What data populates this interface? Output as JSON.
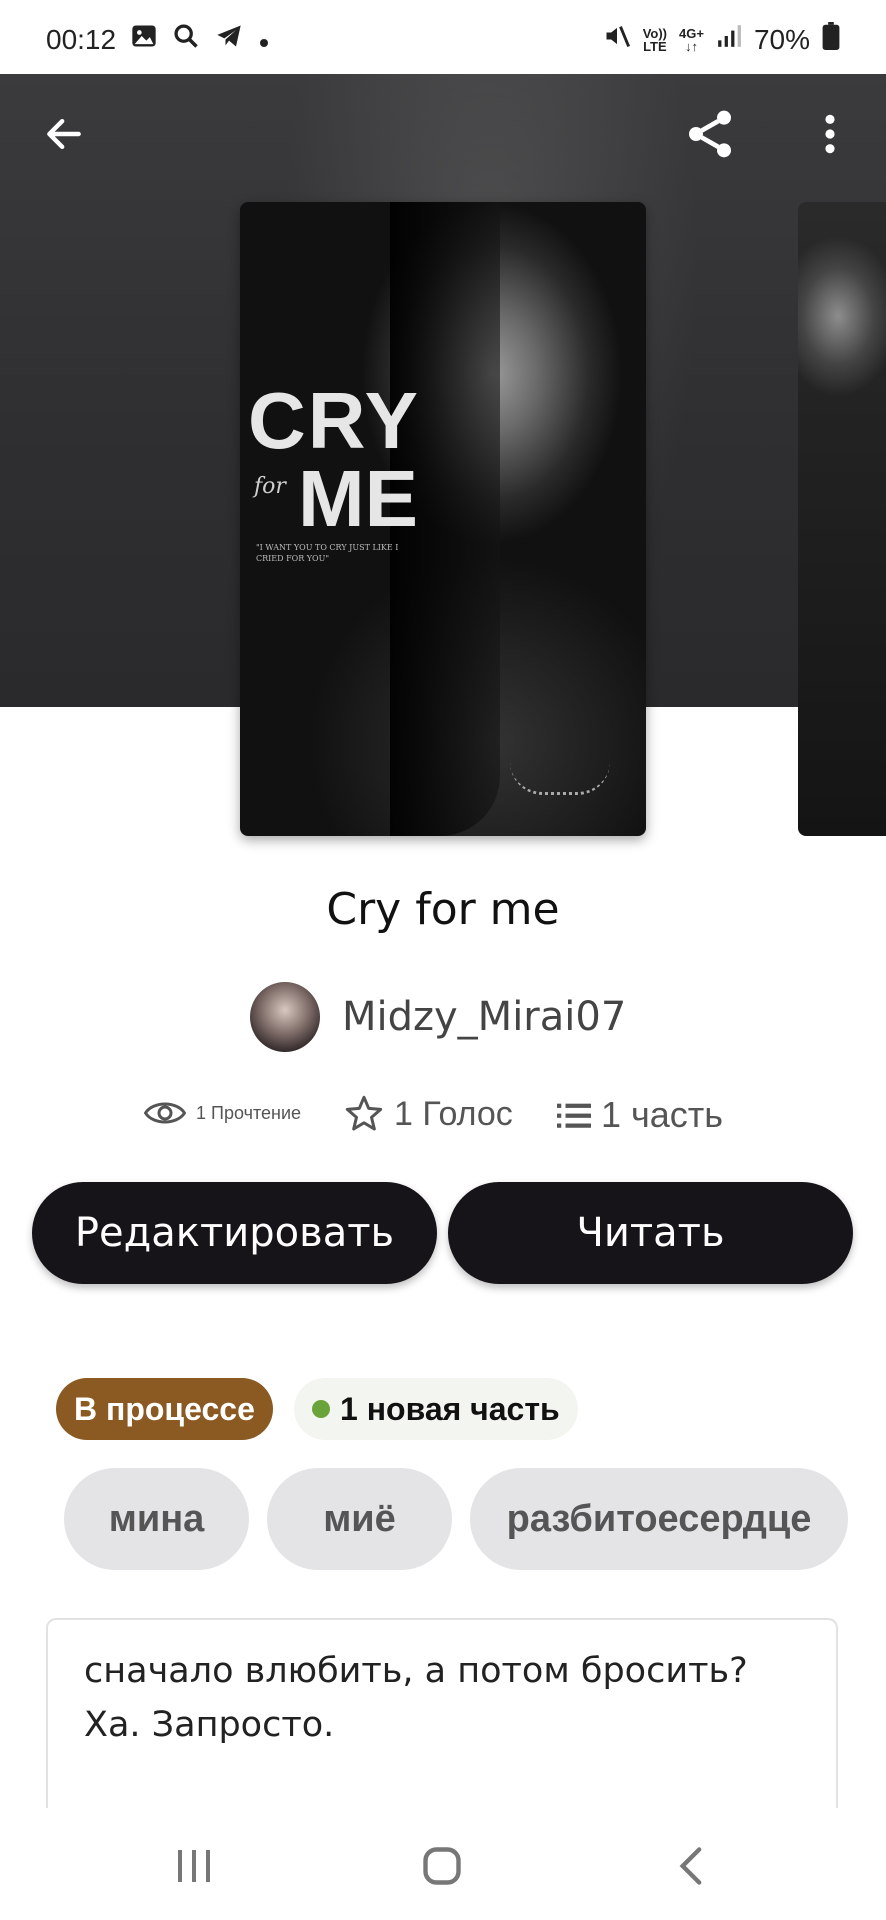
{
  "status_bar": {
    "time": "00:12",
    "battery": "70%",
    "volte_top": "Vo))",
    "volte_bottom": "LTE",
    "network": "4G+"
  },
  "cover": {
    "title_main": "CRY",
    "title_for": "for",
    "title_second": "ME",
    "quote": "\"I WANT YOU TO CRY JUST LIKE I CRIED FOR YOU\""
  },
  "story": {
    "title": "Cry for me",
    "author": "Midzy_Mirai07",
    "reads": "1 Прочтение",
    "votes": "1 Голос",
    "parts": "1 часть"
  },
  "actions": {
    "edit_label": "Редактировать",
    "read_label": "Читать"
  },
  "badges": {
    "status": "В процессе",
    "new_part": "1 новая часть"
  },
  "tags": [
    "мина",
    "миё",
    "разбитоесердце"
  ],
  "description": {
    "line1": "сначало влюбить, а потом бросить?",
    "line2": "Ха.  Запросто."
  },
  "colors": {
    "button_bg": "#161418",
    "status_badge_bg": "#8b5a22",
    "new_part_dot": "#6aa33a",
    "tag_bg": "#e4e3e6"
  }
}
